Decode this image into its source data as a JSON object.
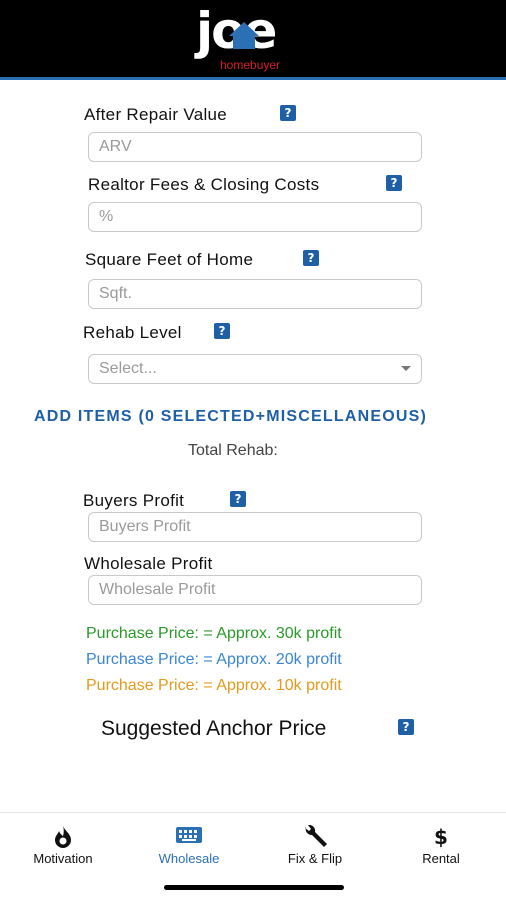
{
  "header": {
    "logo_word": "joe",
    "logo_sub": "homebuyer",
    "colors": {
      "bg": "#000000",
      "accent": "#2b6fb5",
      "sub": "#d4202a"
    }
  },
  "help_glyph": "?",
  "form": {
    "arv": {
      "label": "After Repair Value",
      "placeholder": "ARV"
    },
    "fees": {
      "label": "Realtor Fees & Closing Costs",
      "placeholder": "%"
    },
    "sqft": {
      "label": "Square Feet of Home",
      "placeholder": "Sqft."
    },
    "rehab": {
      "label": "Rehab Level",
      "selected": "Select..."
    },
    "add_items": "ADD ITEMS (0 SELECTED+MISCELLANEOUS)",
    "total_rehab": "Total Rehab:",
    "buyers_profit": {
      "label": "Buyers Profit",
      "placeholder": "Buyers Profit"
    },
    "wholesale_profit": {
      "label": "Wholesale Profit",
      "placeholder": "Wholesale Profit"
    }
  },
  "prices": [
    {
      "text": "Purchase Price:  = Approx. 30k profit",
      "color": "#2a9a2a"
    },
    {
      "text": "Purchase Price:  = Approx. 20k profit",
      "color": "#3a86d4"
    },
    {
      "text": "Purchase Price:  = Approx. 10k profit",
      "color": "#e39a1d"
    }
  ],
  "anchor": "Suggested Anchor Price",
  "tabs": [
    {
      "label": "Motivation",
      "icon": "flame-icon",
      "active": false
    },
    {
      "label": "Wholesale",
      "icon": "keyboard-icon",
      "active": true
    },
    {
      "label": "Fix & Flip",
      "icon": "wrench-icon",
      "active": false
    },
    {
      "label": "Rental",
      "icon": "dollar-icon",
      "active": false
    }
  ],
  "colors": {
    "active_tab": "#2b6fb5",
    "link": "#1f5fa6"
  }
}
